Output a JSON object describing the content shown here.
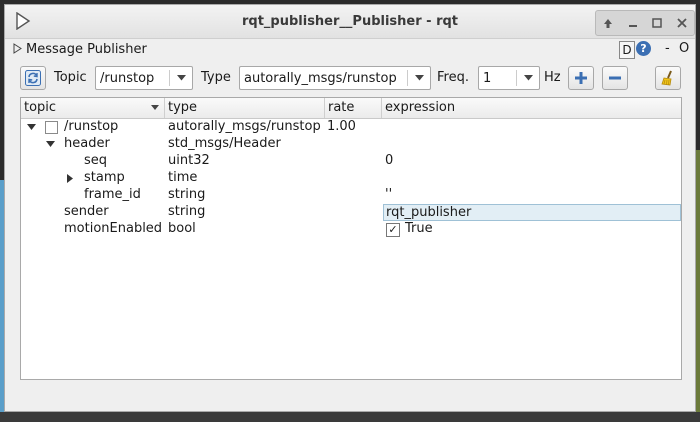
{
  "window": {
    "title": "rqt_publisher__Publisher - rqt",
    "buttons": [
      "up",
      "minimize",
      "maximize",
      "close"
    ]
  },
  "plugin": {
    "title": "Message Publisher",
    "d_label": "D",
    "help_label": "?",
    "minus_label": "-",
    "o_label": "O"
  },
  "toolbar": {
    "topic_label": "Topic",
    "topic_value": "/runstop",
    "type_label": "Type",
    "type_value": "autorally_msgs/runstop",
    "freq_label": "Freq.",
    "freq_value": "1",
    "hz_label": "Hz"
  },
  "tree": {
    "columns": [
      "topic",
      "type",
      "rate",
      "expression"
    ],
    "rows": [
      {
        "name": "/runstop",
        "type": "autorally_msgs/runstop",
        "rate": "1.00",
        "expression": ""
      },
      {
        "name": "header",
        "type": "std_msgs/Header",
        "rate": "",
        "expression": ""
      },
      {
        "name": "seq",
        "type": "uint32",
        "rate": "",
        "expression": "0"
      },
      {
        "name": "stamp",
        "type": "time",
        "rate": "",
        "expression": ""
      },
      {
        "name": "frame_id",
        "type": "string",
        "rate": "",
        "expression": "''"
      },
      {
        "name": "sender",
        "type": "string",
        "rate": "",
        "expression": "rqt_publisher"
      },
      {
        "name": "motionEnabled",
        "type": "bool",
        "rate": "",
        "expression": "True"
      }
    ]
  },
  "colors": {
    "accent_blue": "#3b6fb3",
    "edit_highlight": "#e2eef5"
  }
}
